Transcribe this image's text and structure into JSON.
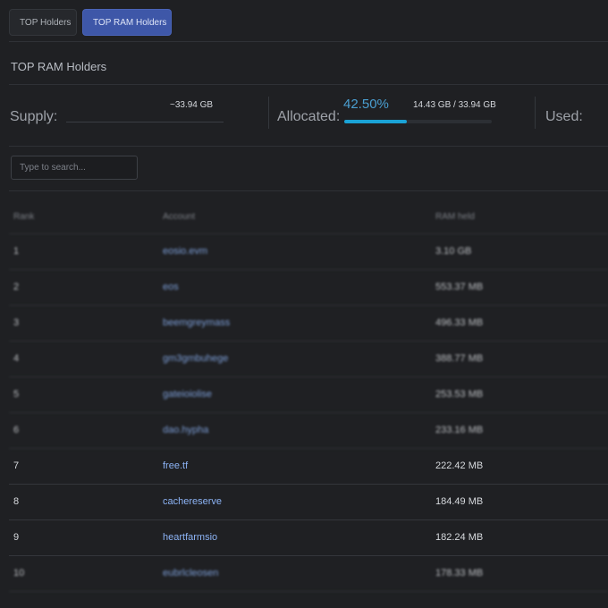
{
  "tabs": [
    {
      "label": "TOP Holders",
      "active": false
    },
    {
      "label": "TOP RAM Holders",
      "active": true
    }
  ],
  "section_title": "TOP RAM Holders",
  "stats": {
    "supply_label": "Supply:",
    "supply_value": "~33.94 GB",
    "allocated_label": "Allocated:",
    "allocated_percent": "42.50%",
    "allocated_fraction": 0.425,
    "allocated_value": "14.43 GB / 33.94 GB",
    "used_label": "Used:"
  },
  "search": {
    "placeholder": "Type to search..."
  },
  "table": {
    "headers": {
      "rank": "Rank",
      "account": "Account",
      "ram": "RAM held"
    },
    "rows": [
      {
        "rank": "1",
        "account": "eosio.evm",
        "ram": "3.10 GB"
      },
      {
        "rank": "2",
        "account": "eos",
        "ram": "553.37 MB"
      },
      {
        "rank": "3",
        "account": "beemgreymass",
        "ram": "496.33 MB"
      },
      {
        "rank": "4",
        "account": "gm3gmbuhege",
        "ram": "388.77 MB"
      },
      {
        "rank": "5",
        "account": "gateioiolise",
        "ram": "253.53 MB"
      },
      {
        "rank": "6",
        "account": "dao.hypha",
        "ram": "233.16 MB"
      },
      {
        "rank": "7",
        "account": "free.tf",
        "ram": "222.42 MB"
      },
      {
        "rank": "8",
        "account": "cachereserve",
        "ram": "184.49 MB"
      },
      {
        "rank": "9",
        "account": "heartfarmsio",
        "ram": "182.24 MB"
      },
      {
        "rank": "10",
        "account": "eubrlcleosen",
        "ram": "178.33 MB"
      }
    ]
  }
}
